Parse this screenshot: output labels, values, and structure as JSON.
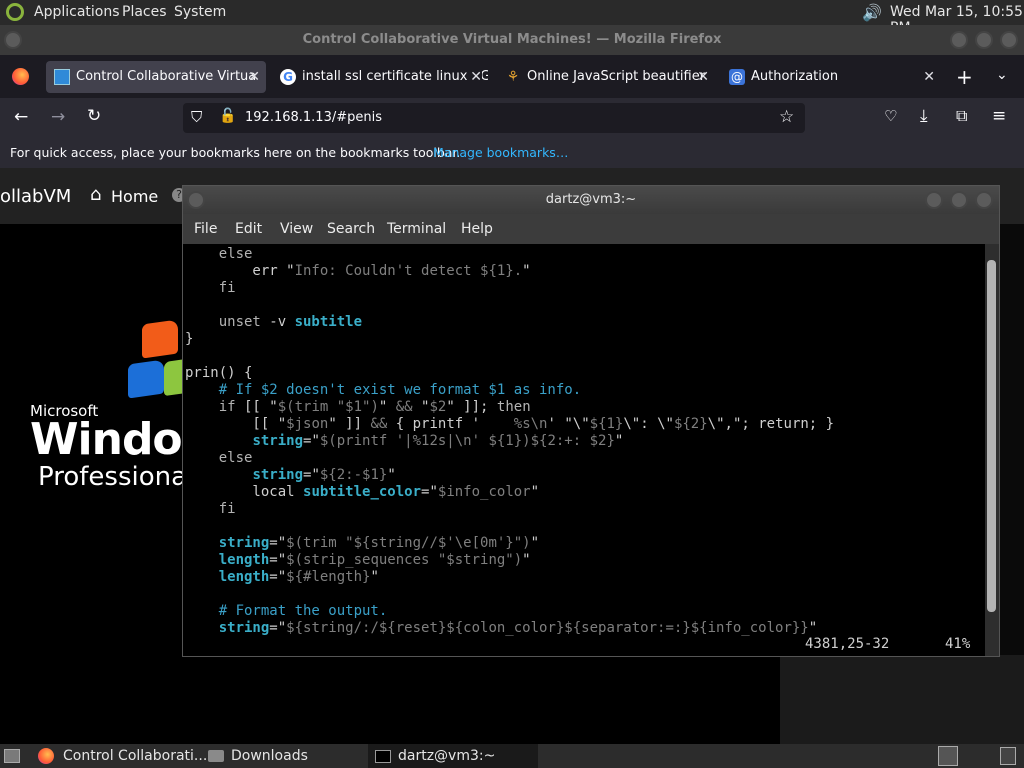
{
  "panel": {
    "applications": "Applications",
    "places": "Places",
    "system": "System",
    "clock": "Wed Mar 15, 10:55 PM"
  },
  "firefox": {
    "window_title": "Control Collaborative Virtual Machines! — Mozilla Firefox",
    "tabs": [
      {
        "label": "Control Collaborative Virtua",
        "icon": "monitor-icon",
        "active": true
      },
      {
        "label": "install ssl certificate linux - G",
        "icon": "google-icon",
        "active": false
      },
      {
        "label": "Online JavaScript beautifier",
        "icon": "beautifier-icon",
        "active": false
      },
      {
        "label": "Authorization",
        "icon": "at-icon",
        "active": false
      }
    ],
    "url": "192.168.1.13/#penis",
    "bookmarks_message": "For quick access, place your bookmarks here on the bookmarks toolbar.",
    "manage_bookmarks": "Manage bookmarks…"
  },
  "site": {
    "brand": "ollabVM",
    "home": "Home",
    "xp_microsoft": "Microsoft",
    "xp_windows": "Windows",
    "xp_edition": "Professional"
  },
  "terminal": {
    "title": "dartz@vm3:~",
    "menu": [
      "File",
      "Edit",
      "View",
      "Search",
      "Terminal",
      "Help"
    ],
    "position": "4381,25-32",
    "percent": "41%"
  },
  "taskbar": {
    "items": [
      {
        "label": "Control Collaborati...",
        "icon": "firefox-icon"
      },
      {
        "label": "Downloads",
        "icon": "folder-icon"
      },
      {
        "label": "dartz@vm3:~",
        "icon": "terminal-icon"
      }
    ]
  },
  "colors": {
    "panel_bg": "#2a2a2a",
    "tab_active": "#42414d",
    "link": "#33b8ff",
    "code_keyword": "#3aaec8"
  }
}
